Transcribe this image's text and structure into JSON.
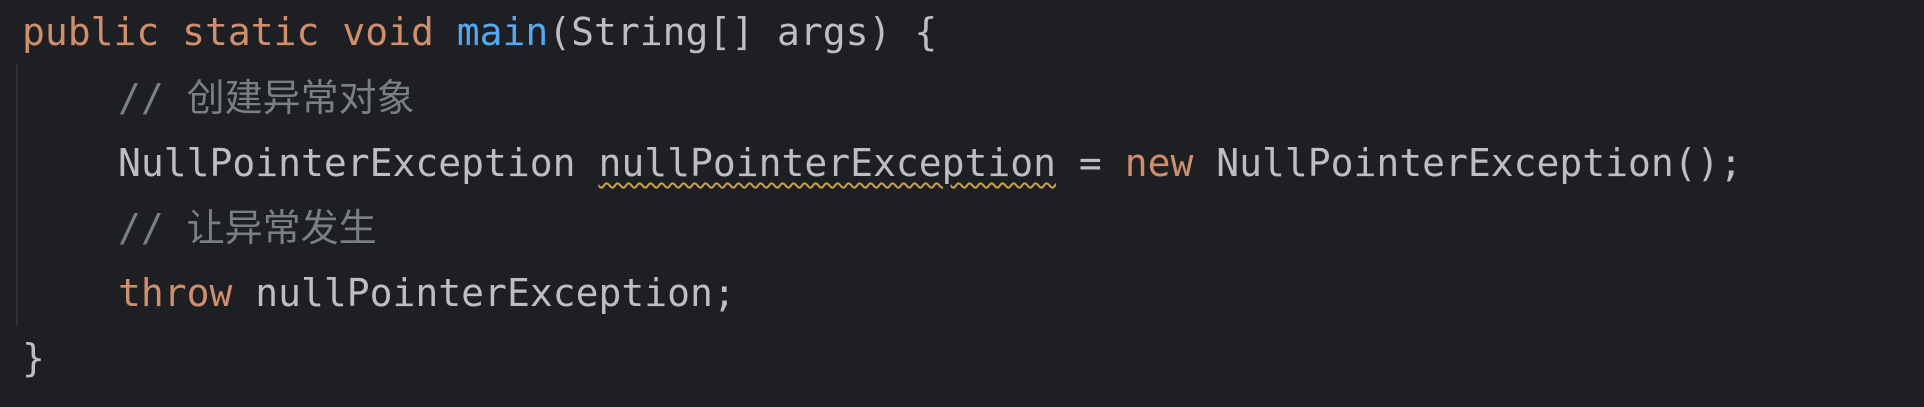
{
  "code": {
    "line1": {
      "kw_public": "public",
      "kw_static": "static",
      "kw_void": "void",
      "method_name": "main",
      "params": "(String[] args)",
      "brace_open": "{"
    },
    "line2": {
      "comment": "// 创建异常对象"
    },
    "line3": {
      "type_name": "NullPointerException",
      "var_name": "nullPointerException",
      "assign": "=",
      "kw_new": "new",
      "ctor_call": "NullPointerException();"
    },
    "line4": {
      "comment": "// 让异常发生"
    },
    "line5": {
      "kw_throw": "throw",
      "throw_expr": "nullPointerException;"
    },
    "line6": {
      "brace_close": "}"
    }
  },
  "colors": {
    "background": "#1e1f22",
    "keyword": "#cf8e6d",
    "method": "#56a8f5",
    "text": "#bcbec4",
    "comment": "#7a7e85",
    "warning_underline": "#c9a14a"
  }
}
